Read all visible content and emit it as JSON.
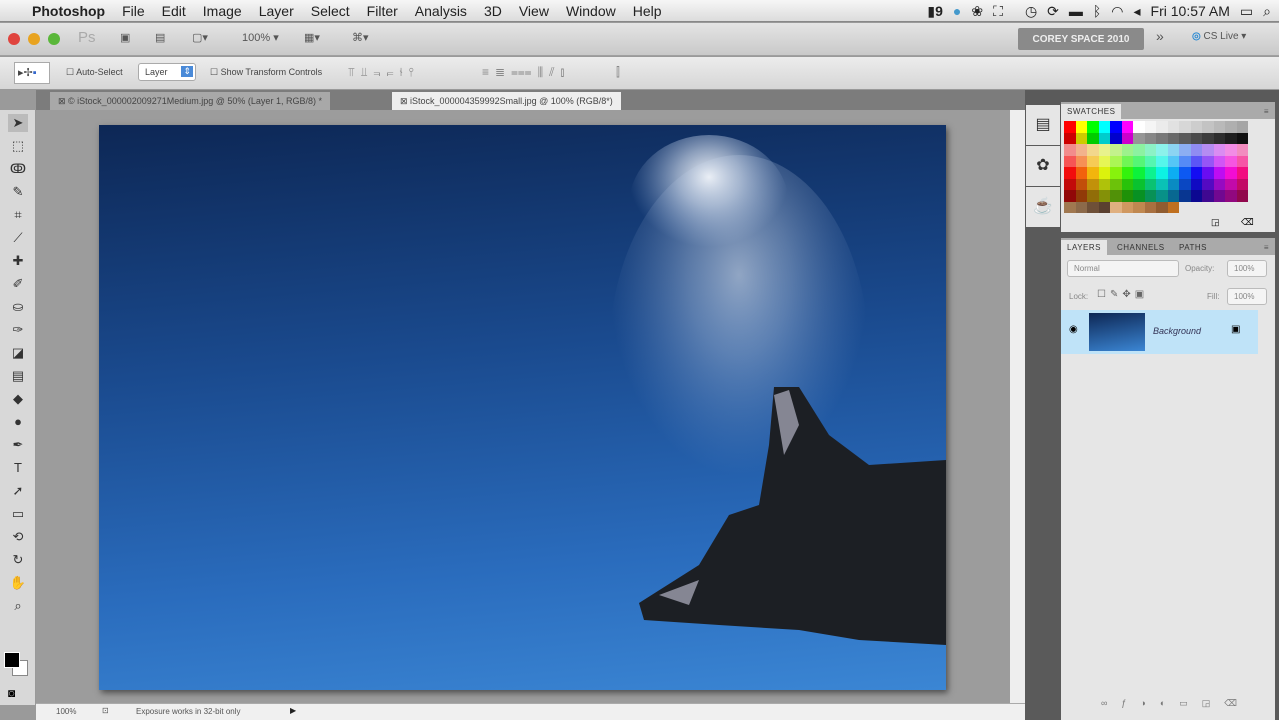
{
  "menubar": {
    "app": "Photoshop",
    "items": [
      "File",
      "Edit",
      "Image",
      "Layer",
      "Select",
      "Filter",
      "Analysis",
      "3D",
      "View",
      "Window",
      "Help"
    ],
    "status_num": "9",
    "clock": "Fri 10:57 AM"
  },
  "appbar": {
    "logo": "Ps",
    "zoom": "100%",
    "workspace": "COREY SPACE 2010",
    "overflow": "»",
    "cslive": "CS Live"
  },
  "options": {
    "auto_select": "Auto-Select",
    "layer_select": "Layer",
    "show_transform": "Show Transform Controls"
  },
  "tabs": [
    {
      "label": "© iStock_000002009271Medium.jpg @ 50% (Layer 1, RGB/8) *"
    },
    {
      "label": "iStock_000004359992Small.jpg @ 100% (RGB/8*)"
    }
  ],
  "status": {
    "zoom": "100%",
    "message": "Exposure works in 32-bit only"
  },
  "swatches": {
    "title": "SWATCHES"
  },
  "layers": {
    "tabs": [
      "LAYERS",
      "CHANNELS",
      "PATHS"
    ],
    "blend": "Normal",
    "opacity_label": "Opacity:",
    "opacity": "100%",
    "lock_label": "Lock:",
    "fill_label": "Fill:",
    "fill": "100%",
    "layer_name": "Background"
  },
  "colors": {
    "accent": "#bfe3f8",
    "image_top": "#0d2755",
    "image_bottom": "#3b86d4"
  }
}
